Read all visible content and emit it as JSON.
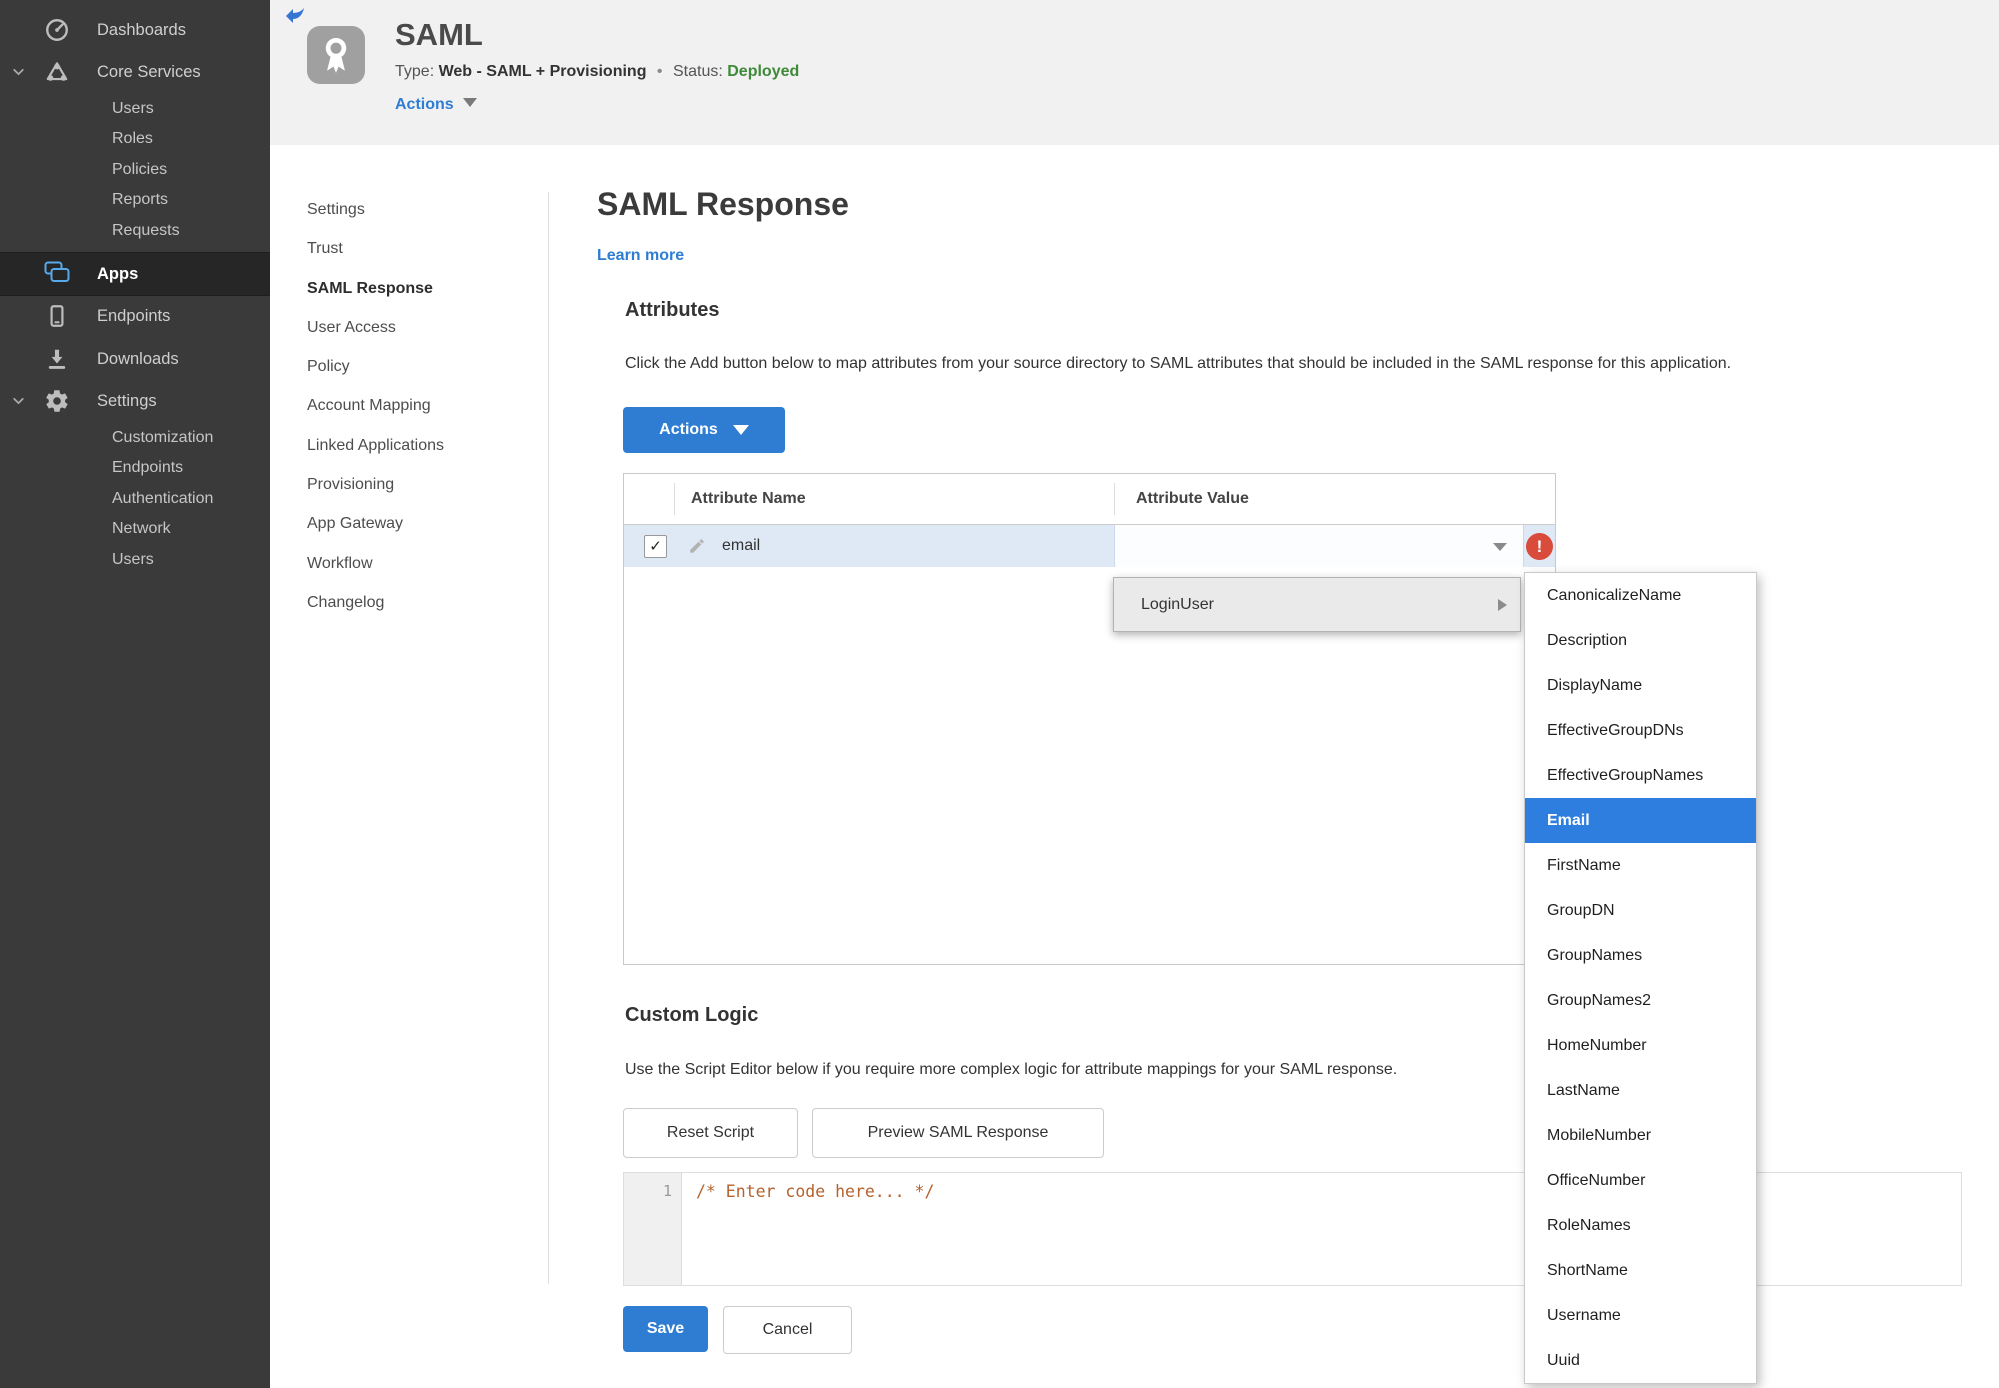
{
  "sidebar": {
    "dashboards": "Dashboards",
    "core_services": "Core Services",
    "core_sub": [
      "Users",
      "Roles",
      "Policies",
      "Reports",
      "Requests"
    ],
    "apps": "Apps",
    "endpoints": "Endpoints",
    "downloads": "Downloads",
    "settings": "Settings",
    "settings_sub": [
      "Customization",
      "Endpoints",
      "Authentication",
      "Network",
      "Users"
    ]
  },
  "header": {
    "app_name": "SAML",
    "type_label": "Type:",
    "type_value": "Web - SAML + Provisioning",
    "separator": "•",
    "status_label": "Status:",
    "status_value": "Deployed",
    "actions_label": "Actions"
  },
  "subnav": {
    "items": [
      "Settings",
      "Trust",
      "SAML Response",
      "User Access",
      "Policy",
      "Account Mapping",
      "Linked Applications",
      "Provisioning",
      "App Gateway",
      "Workflow",
      "Changelog"
    ],
    "active": "SAML Response"
  },
  "main": {
    "title": "SAML Response",
    "learn_more": "Learn more",
    "attributes_heading": "Attributes",
    "attributes_description": "Click the Add button below to map attributes from your source directory to SAML attributes that should be included in the SAML response for this application.",
    "actions_button": "Actions",
    "table": {
      "col_name": "Attribute Name",
      "col_value": "Attribute Value",
      "rows": [
        {
          "name": "email",
          "checked": true,
          "value": "",
          "error": true
        }
      ]
    },
    "custom_logic_heading": "Custom Logic",
    "custom_logic_description": "Use the Script Editor below if you require more complex logic for attribute mappings for your SAML response.",
    "reset_button": "Reset Script",
    "preview_button": "Preview SAML Response",
    "editor": {
      "line_number": "1",
      "code": "/* Enter code here... */"
    },
    "save_button": "Save",
    "cancel_button": "Cancel"
  },
  "menu": {
    "parent_label": "LoginUser",
    "items": [
      "CanonicalizeName",
      "Description",
      "DisplayName",
      "EffectiveGroupDNs",
      "EffectiveGroupNames",
      "Email",
      "FirstName",
      "GroupDN",
      "GroupNames",
      "GroupNames2",
      "HomeNumber",
      "LastName",
      "MobileNumber",
      "OfficeNumber",
      "RoleNames",
      "ShortName",
      "Username",
      "Uuid"
    ],
    "selected": "Email"
  },
  "icons": {
    "check_glyph": "✓",
    "error_glyph": "!"
  },
  "colors": {
    "accent_blue": "#2e7dd2",
    "selected_item_blue": "#2e7ee0",
    "status_green": "#3e8a39",
    "error_red": "#d94b3a",
    "row_highlight": "#dfe9f6",
    "sidebar_bg": "#3a3a3a",
    "header_bg": "#f1f1f2"
  }
}
